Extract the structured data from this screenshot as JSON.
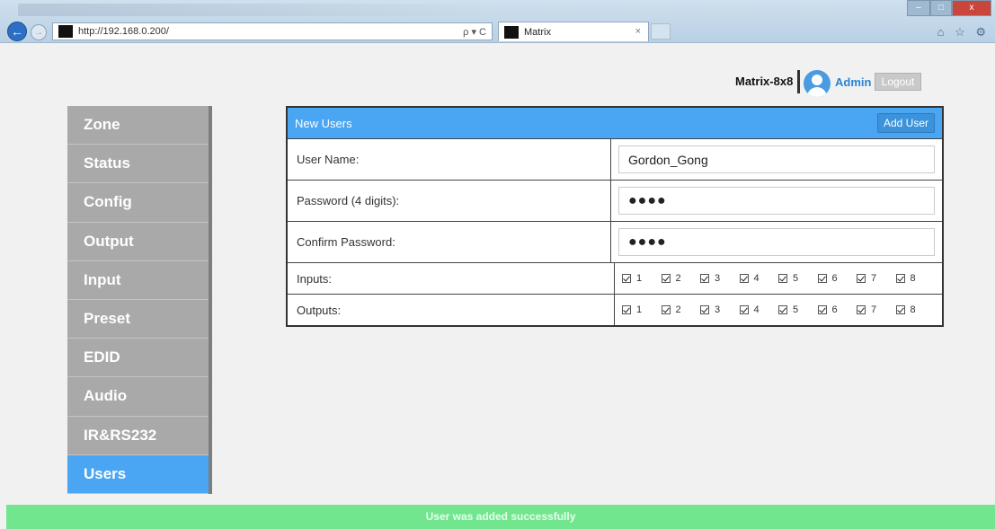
{
  "browser": {
    "url": "http://192.168.0.200/",
    "tab_title": "Matrix",
    "tab_close": "×",
    "search_tools": "ρ ▾ C",
    "minimize": "–",
    "maximize": "□",
    "close": "x",
    "toolbar_icons": "⌂ ☆ ⚙"
  },
  "header": {
    "device_name": "Matrix-8x8",
    "user": "Admin",
    "logout_label": "Logout"
  },
  "sidebar": {
    "items": [
      {
        "label": "Zone"
      },
      {
        "label": "Status"
      },
      {
        "label": "Config"
      },
      {
        "label": "Output"
      },
      {
        "label": "Input"
      },
      {
        "label": "Preset"
      },
      {
        "label": "EDID"
      },
      {
        "label": "Audio"
      },
      {
        "label": "IR&RS232"
      },
      {
        "label": "Users"
      }
    ],
    "active": "Users"
  },
  "panel": {
    "title": "New Users",
    "add_user_label": "Add User",
    "username_label": "User Name:",
    "username_value": "Gordon_Gong",
    "password_label": "Password (4 digits):",
    "password_value": "●●●●",
    "confirm_label": "Confirm Password:",
    "confirm_value": "●●●●",
    "inputs_label": "Inputs:",
    "outputs_label": "Outputs:",
    "inputs": [
      "1",
      "2",
      "3",
      "4",
      "5",
      "6",
      "7",
      "8"
    ],
    "outputs": [
      "1",
      "2",
      "3",
      "4",
      "5",
      "6",
      "7",
      "8"
    ]
  },
  "status_message": "User was added successfully",
  "colors": {
    "accent": "#4aa6f2",
    "sidebar": "#a9a9a9",
    "success": "#72e68f"
  }
}
